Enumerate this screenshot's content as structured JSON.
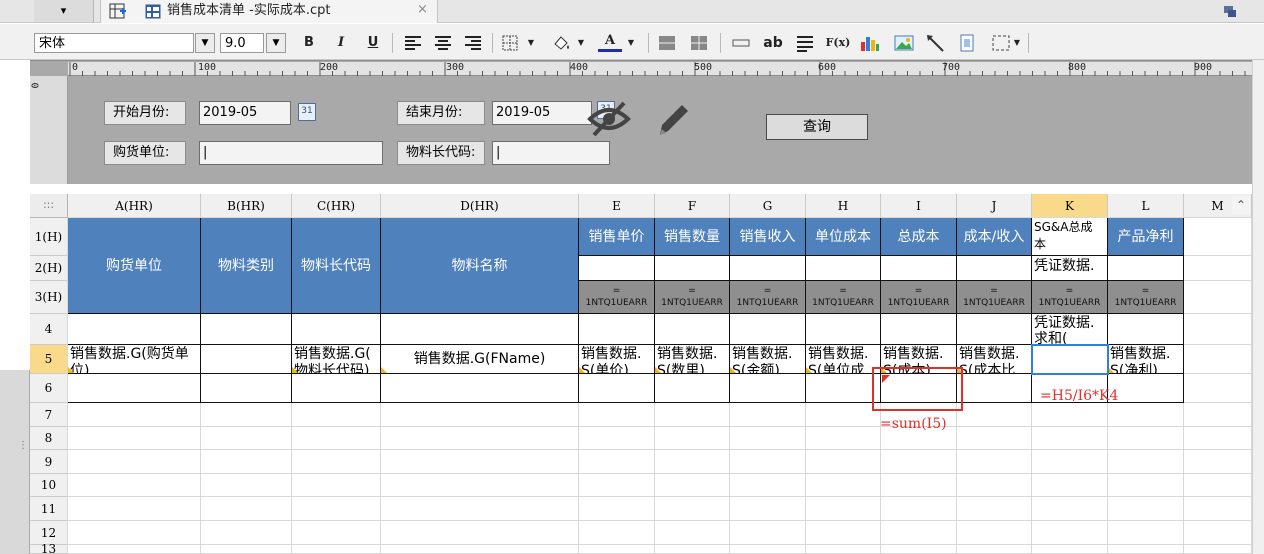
{
  "tab": {
    "title": "销售成本清单 -实际成本.cpt",
    "close": "×"
  },
  "toolbar": {
    "font_name": "宋体",
    "font_size": "9.0",
    "bold": "B",
    "italic": "I",
    "underline": "U",
    "font_color": "A",
    "text_tool": "ab",
    "formula_tool": "F(x)"
  },
  "ruler": {
    "ticks": [
      "0",
      "100",
      "200",
      "300",
      "400",
      "500",
      "600",
      "700",
      "800",
      "900"
    ],
    "vertical_zero": "0"
  },
  "params": {
    "start_month_label": "开始月份:",
    "start_month_value": "2019-05",
    "end_month_label": "结束月份:",
    "end_month_value": "2019-05",
    "buyer_label": "购货单位:",
    "material_code_label": "物料长代码:",
    "query_button": "查询",
    "calendar_icon_text": "31"
  },
  "sheet": {
    "corner": ":::",
    "columns": [
      "A(HR)",
      "B(HR)",
      "C(HR)",
      "D(HR)",
      "E",
      "F",
      "G",
      "H",
      "I",
      "J",
      "K",
      "L",
      "M"
    ],
    "rows": [
      "1(H)",
      "2(H)",
      "3(H)",
      "4",
      "5",
      "6",
      "7",
      "8",
      "9",
      "10",
      "11",
      "12",
      "13"
    ],
    "header_cells": {
      "buyer": "购货单位",
      "material_type": "物料类别",
      "material_code": "物料长代码",
      "material_name": "物料名称",
      "unit_price": "销售单价",
      "qty": "销售数量",
      "revenue": "销售收入",
      "unit_cost": "单位成本",
      "total_cost": "总成本",
      "cost_ratio": "成本/收入",
      "sga_line1": "SG&A总成",
      "sga_line2": "本",
      "net_profit": "产品净利"
    },
    "row2": {
      "k": "凭证数据."
    },
    "row3": {
      "eq": "=",
      "formula": "1NTQ1UEARR",
      "k_formula": "1NTQ1UEARR"
    },
    "row4": {
      "k_line1": "凭证数据.",
      "k_line2": "求和("
    },
    "row5": {
      "a_line1": "销售数据.G(购货单",
      "a_line2": "位)",
      "c_line1": "销售数据.G(",
      "c_line2": "物料长代码)",
      "d": "销售数据.G(FName)",
      "e_line1": "销售数据.",
      "e_line2": "S(单价)",
      "f_line1": "销售数据.",
      "f_line2": "S(数里)",
      "g_line1": "销售数据.",
      "g_line2": "S(金额)",
      "h_line1": "销售数据.",
      "h_line2": "S(单位成",
      "i_line1": "销售数据.",
      "i_line2": "S(成本)",
      "j_line1": "销售数据.",
      "j_line2": "S(成本比",
      "l_line1": "销售数据.",
      "l_line2": "S(净利)"
    },
    "annotations": {
      "sum_formula": "=sum(I5)",
      "ratio_formula": "=H5/I6*K4"
    }
  },
  "colors": {
    "header_blue": "#4f81bd",
    "formula_gray": "#8f8f8f",
    "annotation_red": "#e0302a",
    "selection_blue": "#2f7fe0",
    "param_bg": "#a9a9a9"
  },
  "icons": [
    "new-sheet-icon",
    "report-icon",
    "close-icon",
    "align-left-icon",
    "align-center-icon",
    "align-right-icon",
    "border-icon",
    "fill-color-icon",
    "chart-icon",
    "image-icon",
    "hide-eye-icon",
    "pencil-icon"
  ]
}
